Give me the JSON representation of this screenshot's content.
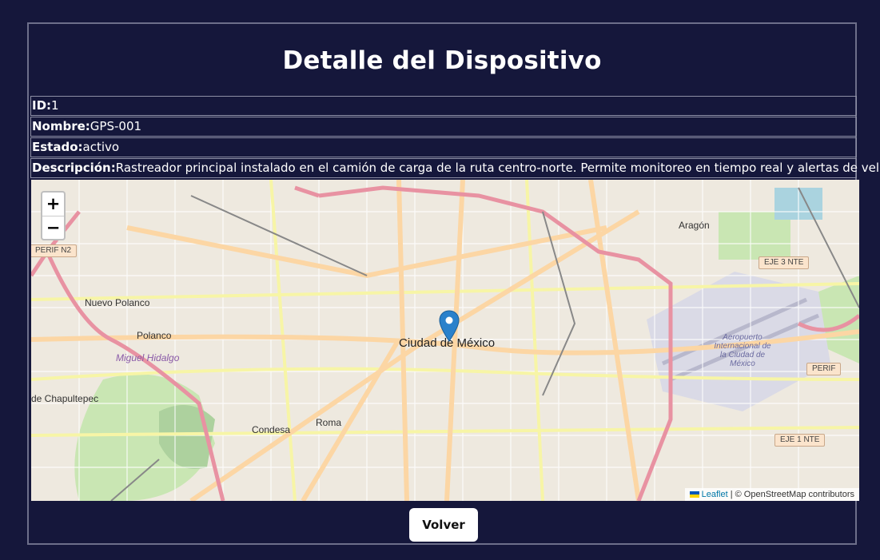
{
  "page": {
    "title": "Detalle del Dispositivo"
  },
  "device": {
    "id_label": "ID:",
    "id_value": "1",
    "name_label": "Nombre:",
    "name_value": "GPS-001",
    "status_label": "Estado:",
    "status_value": "activo",
    "description_label": "Descripción:",
    "description_value": "Rastreador principal instalado en el camión de carga de la ruta centro-norte. Permite monitoreo en tiempo real y alertas de velocidad."
  },
  "map": {
    "zoom_in": "+",
    "zoom_out": "−",
    "attribution_link": "Leaflet",
    "attribution_text": " | © OpenStreetMap contributors",
    "marker_label": "Ciudad de México",
    "labels": {
      "nuevo_polanco": "Nuevo Polanco",
      "polanco": "Polanco",
      "miguel_hidalgo": "Miguel Hidalgo",
      "chapultepec": "de Chapultepec",
      "condesa": "Condesa",
      "roma": "Roma",
      "aragon": "Aragón",
      "aeropuerto": "Aeropuerto Internacional de la Ciudad de México",
      "perif_n2": "PERIF N2",
      "eje3": "EJE 3 NTE",
      "eje1": "EJE 1 NTE",
      "perif": "PERIF"
    }
  },
  "actions": {
    "back_label": "Volver"
  },
  "colors": {
    "background": "#15173b",
    "border": "#6d6f8a",
    "marker": "#2a81cb"
  }
}
